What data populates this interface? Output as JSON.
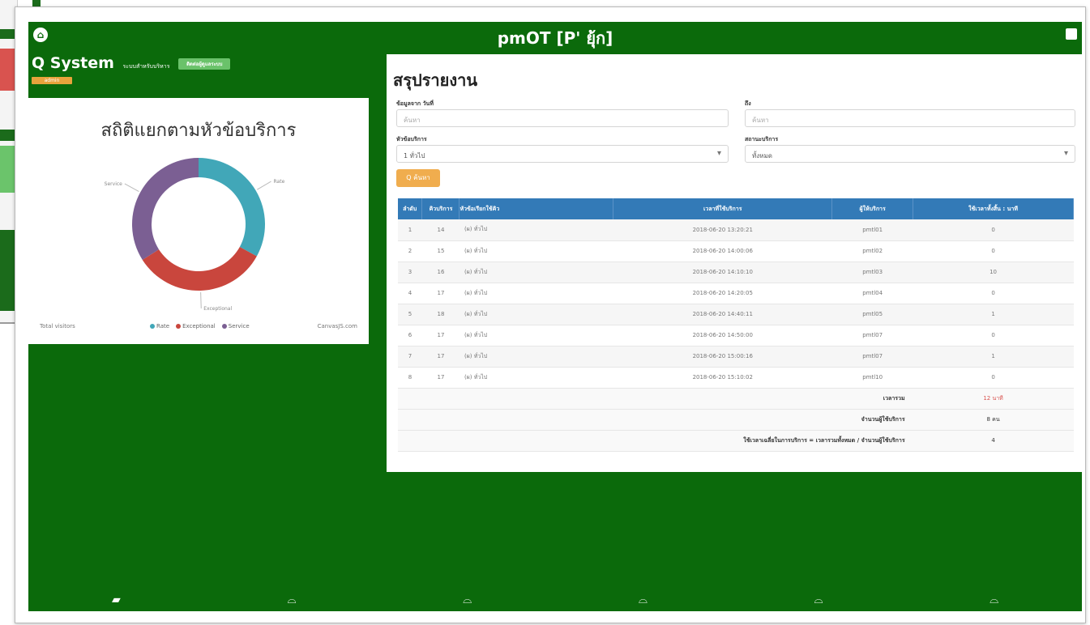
{
  "window": {
    "title": "pmOT [P' ยุ้ก]"
  },
  "brand": {
    "name": "Q System",
    "subtitle": "ระบบสำหรับบริหาร",
    "pill": "ติดต่อผู้ดูแลระบบ",
    "badge": "admin"
  },
  "chart": {
    "title": "สถิติแยกตามหัวข้อบริการ",
    "foot_left": "Total visitors",
    "foot_right": "CanvasJS.com"
  },
  "chart_data": {
    "type": "pie",
    "title": "สถิติแยกตามหัวข้อบริการ",
    "categories": [
      "Rate",
      "Exceptional",
      "Service"
    ],
    "values": [
      33,
      33,
      34
    ],
    "colors": [
      "#41a7b8",
      "#c9463d",
      "#7b5f93"
    ],
    "legend_position": "bottom"
  },
  "report": {
    "title": "สรุปรายงาน",
    "start_label": "ข้อมูลจาก วันที่",
    "start_placeholder": "ค้นหา",
    "end_label": "ถึง",
    "end_placeholder": "ค้นหา",
    "topic_label": "หัวข้อบริการ",
    "topic_value": "1 ทั่วไป",
    "status_label": "สถานะบริการ",
    "status_value": "ทั้งหมด",
    "search_button": "Q ค้นหา",
    "columns": [
      "ลำดับ",
      "คิวบริการ",
      "หัวข้อเรียกใช้คิว",
      "เวลาที่ใช้บริการ",
      "ผู้ให้บริการ",
      "ใช้เวลาทั้งสิ้น : นาที"
    ],
    "rows": [
      [
        "1",
        "14",
        "(ผ) ทั่วไป",
        "2018-06-20 13:20:21",
        "pmtl01",
        "0"
      ],
      [
        "2",
        "15",
        "(ผ) ทั่วไป",
        "2018-06-20 14:00:06",
        "pmtl02",
        "0"
      ],
      [
        "3",
        "16",
        "(ผ) ทั่วไป",
        "2018-06-20 14:10:10",
        "pmtl03",
        "10"
      ],
      [
        "4",
        "17",
        "(ผ) ทั่วไป",
        "2018-06-20 14:20:05",
        "pmtl04",
        "0"
      ],
      [
        "5",
        "18",
        "(ผ) ทั่วไป",
        "2018-06-20 14:40:11",
        "pmtl05",
        "1"
      ],
      [
        "6",
        "17",
        "(ผ) ทั่วไป",
        "2018-06-20 14:50:00",
        "pmtl07",
        "0"
      ],
      [
        "7",
        "17",
        "(ผ) ทั่วไป",
        "2018-06-20 15:00:16",
        "pmtl07",
        "1"
      ],
      [
        "8",
        "17",
        "(ผ) ทั่วไป",
        "2018-06-20 15:10:02",
        "pmtl10",
        "0"
      ]
    ],
    "total_label": "เวลารวม",
    "total_value": "12 นาที",
    "count_label": "จำนวนผู้ใช้บริการ",
    "count_value": "8 คน",
    "avg_label": "ใช้เวลาเฉลี่ยในการบริการ = เวลารวมทั้งหมด / จำนวนผู้ใช้บริการ",
    "avg_value": "4"
  },
  "bottom_nav": [
    "folder-open-icon",
    "folder-icon",
    "folder-icon",
    "folder-icon",
    "folder-icon",
    "folder-icon"
  ]
}
